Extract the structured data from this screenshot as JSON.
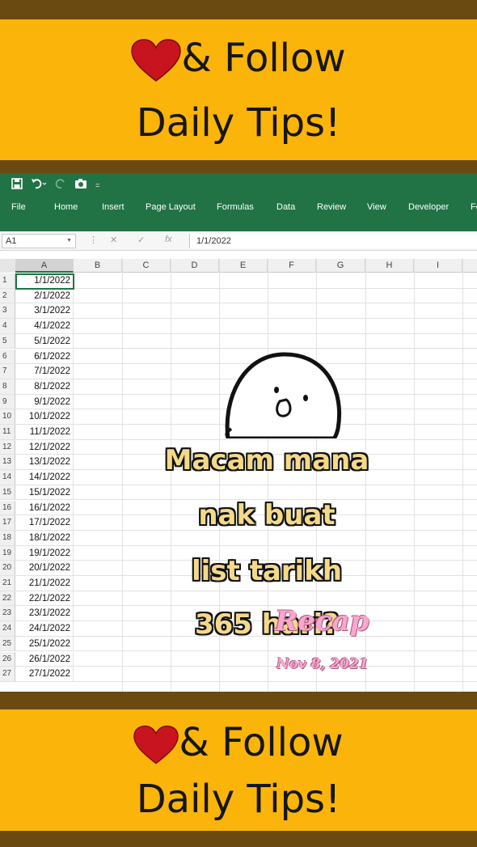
{
  "promo": {
    "line1": "& Follow",
    "line2": "Daily Tips!"
  },
  "excel": {
    "tabs": [
      "File",
      "Home",
      "Insert",
      "Page Layout",
      "Formulas",
      "Data",
      "Review",
      "View",
      "Developer",
      "Fo"
    ],
    "name_box": "A1",
    "formula_value": "1/1/2022",
    "fx_label": "fx",
    "columns": [
      "A",
      "B",
      "C",
      "D",
      "E",
      "F",
      "G",
      "H",
      "I"
    ],
    "rows": [
      {
        "n": "1",
        "a": "1/1/2022"
      },
      {
        "n": "2",
        "a": "2/1/2022"
      },
      {
        "n": "3",
        "a": "3/1/2022"
      },
      {
        "n": "4",
        "a": "4/1/2022"
      },
      {
        "n": "5",
        "a": "5/1/2022"
      },
      {
        "n": "6",
        "a": "6/1/2022"
      },
      {
        "n": "7",
        "a": "7/1/2022"
      },
      {
        "n": "8",
        "a": "8/1/2022"
      },
      {
        "n": "9",
        "a": "9/1/2022"
      },
      {
        "n": "10",
        "a": "10/1/2022"
      },
      {
        "n": "11",
        "a": "11/1/2022"
      },
      {
        "n": "12",
        "a": "12/1/2022"
      },
      {
        "n": "13",
        "a": "13/1/2022"
      },
      {
        "n": "14",
        "a": "14/1/2022"
      },
      {
        "n": "15",
        "a": "15/1/2022"
      },
      {
        "n": "16",
        "a": "16/1/2022"
      },
      {
        "n": "17",
        "a": "17/1/2022"
      },
      {
        "n": "18",
        "a": "18/1/2022"
      },
      {
        "n": "19",
        "a": "19/1/2022"
      },
      {
        "n": "20",
        "a": "20/1/2022"
      },
      {
        "n": "21",
        "a": "21/1/2022"
      },
      {
        "n": "22",
        "a": "22/1/2022"
      },
      {
        "n": "23",
        "a": "23/1/2022"
      },
      {
        "n": "24",
        "a": "24/1/2022"
      },
      {
        "n": "25",
        "a": "25/1/2022"
      },
      {
        "n": "26",
        "a": "26/1/2022"
      },
      {
        "n": "27",
        "a": "27/1/2022"
      }
    ]
  },
  "overlay": {
    "line1": "Macam mana",
    "line2": "nak buat",
    "line3": "list tarikh",
    "line4": "365 hari?",
    "recap_title": "Recap",
    "recap_date": "Nov 8, 2021"
  },
  "colors": {
    "brand_bar": "#fbb409",
    "excel_green": "#217346",
    "heart": "#c8141e",
    "frame": "#6b4a12"
  },
  "icons": [
    "heart-icon",
    "save-icon",
    "undo-icon",
    "redo-icon",
    "camera-icon",
    "cancel-icon",
    "enter-icon"
  ]
}
